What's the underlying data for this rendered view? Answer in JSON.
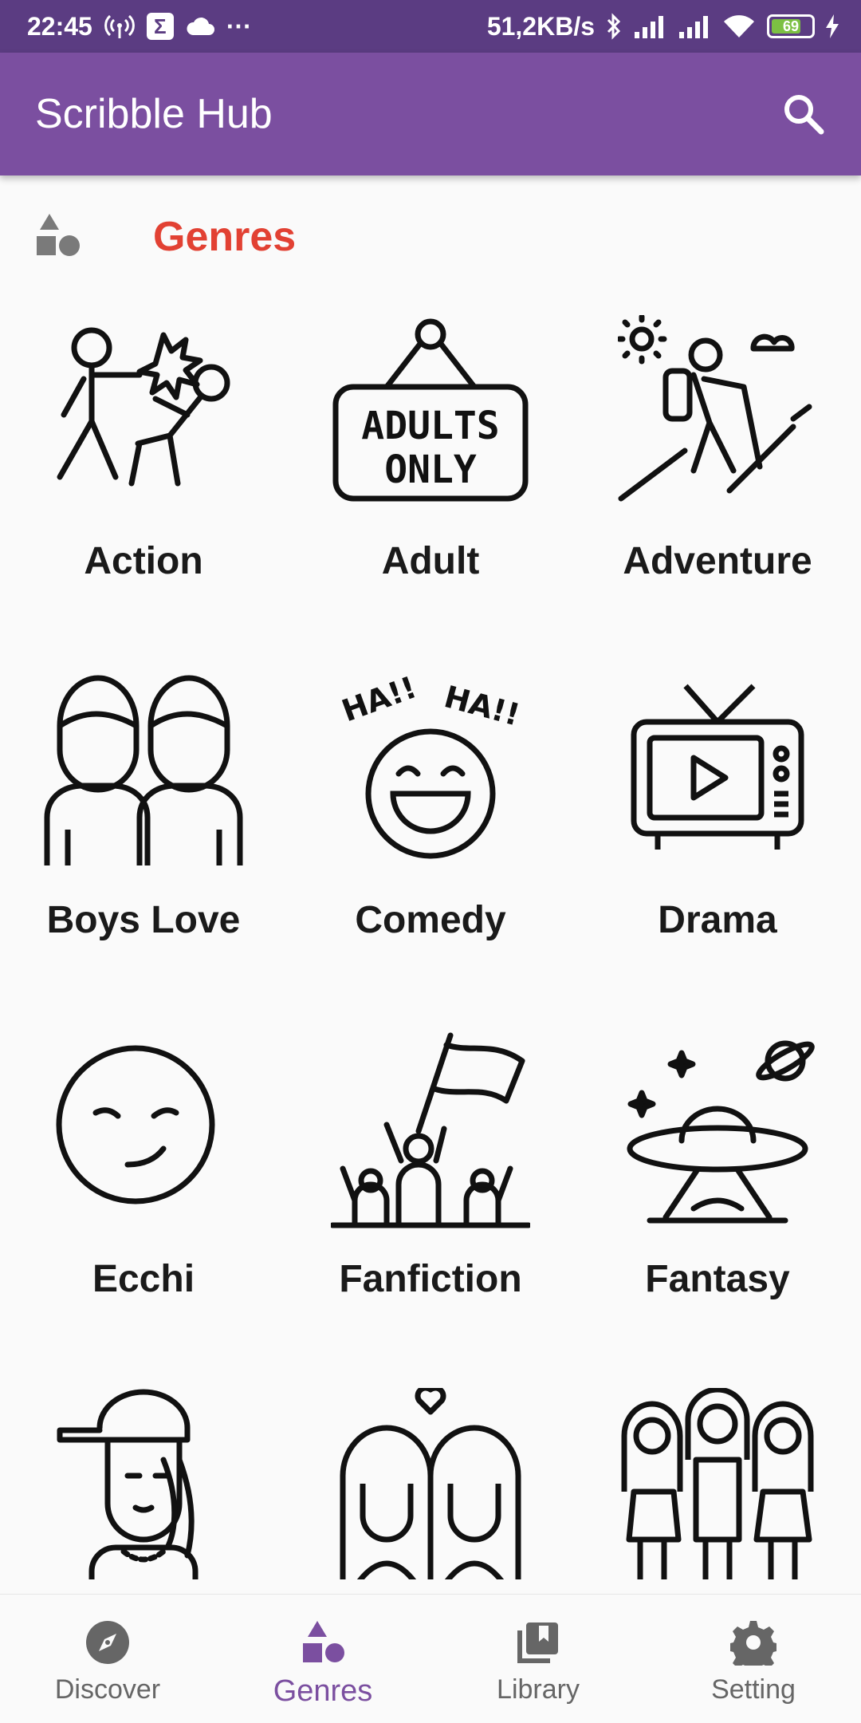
{
  "status_bar": {
    "time": "22:45",
    "sigma": "Σ",
    "more": "···",
    "speed": "51,2KB/s",
    "battery": "69"
  },
  "app_bar": {
    "title": "Scribble Hub",
    "search_icon": "search-icon"
  },
  "section": {
    "title": "Genres",
    "icon": "shapes-icon"
  },
  "genres": [
    {
      "label": "Action",
      "icon": "fight-icon"
    },
    {
      "label": "Adult",
      "icon": "adults-only-sign-icon"
    },
    {
      "label": "Adventure",
      "icon": "hiker-icon"
    },
    {
      "label": "Boys Love",
      "icon": "two-boys-icon"
    },
    {
      "label": "Comedy",
      "icon": "laughing-face-icon"
    },
    {
      "label": "Drama",
      "icon": "tv-icon"
    },
    {
      "label": "Ecchi",
      "icon": "smirk-face-icon"
    },
    {
      "label": "Fanfiction",
      "icon": "fans-flag-icon"
    },
    {
      "label": "Fantasy",
      "icon": "ufo-icon"
    },
    {
      "label": "",
      "icon": "girl-cap-icon"
    },
    {
      "label": "",
      "icon": "two-girls-heart-icon"
    },
    {
      "label": "",
      "icon": "three-girls-icon"
    }
  ],
  "bottom_nav": [
    {
      "label": "Discover",
      "icon": "compass-icon",
      "active": false
    },
    {
      "label": "Genres",
      "icon": "shapes-icon",
      "active": true
    },
    {
      "label": "Library",
      "icon": "library-icon",
      "active": false
    },
    {
      "label": "Setting",
      "icon": "gear-icon",
      "active": false
    }
  ],
  "colors": {
    "status_bar": "#5b3c82",
    "app_bar": "#7b4fa0",
    "section_title": "#e24133",
    "nav_active": "#7b4fa0",
    "nav_inactive": "#666666"
  }
}
